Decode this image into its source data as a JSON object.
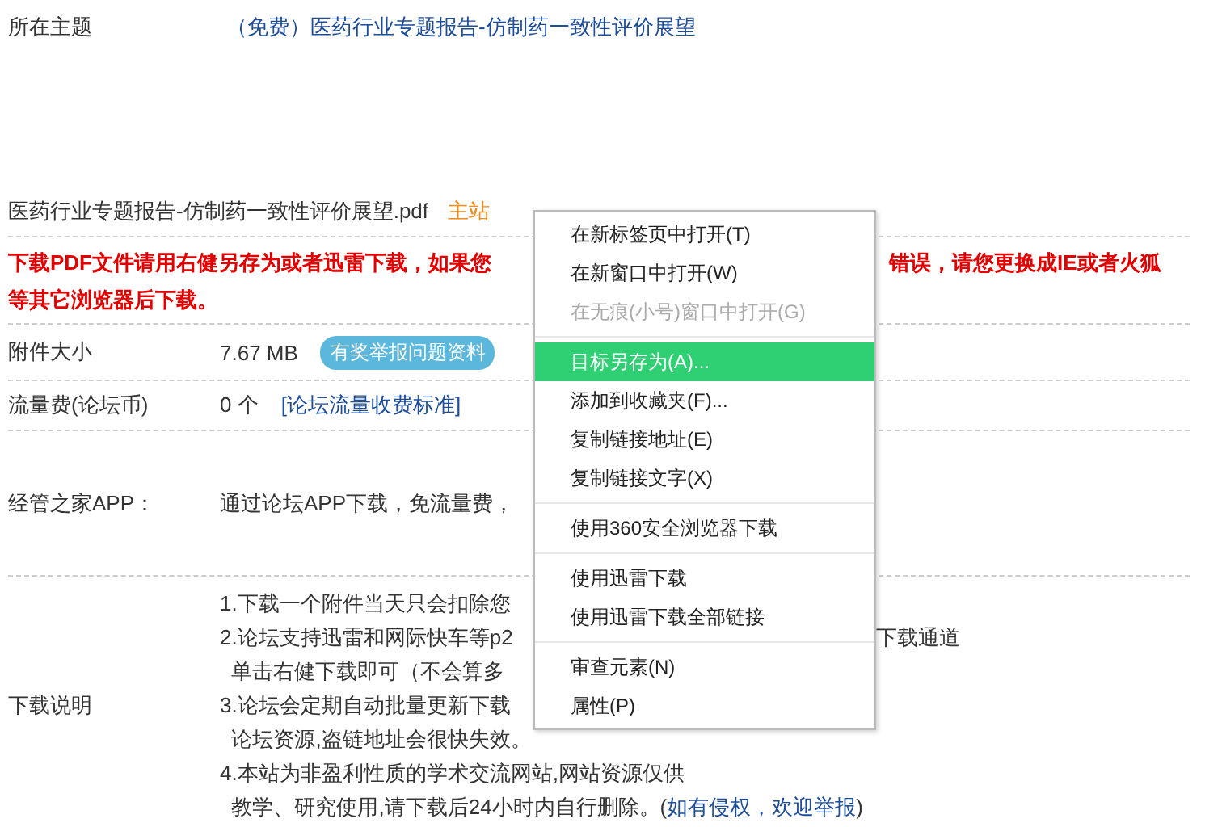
{
  "topic": {
    "label": "所在主题",
    "link": "（免费）医药行业专题报告-仿制药一致性评价展望"
  },
  "file": {
    "name": "医药行业专题报告-仿制药一致性评价展望.pdf",
    "download_link": "主站"
  },
  "notice": {
    "line_1_start": "下载PDF文件请用右健另存为或者迅雷下载，如果您",
    "line_1_end": "错误，请您更换成IE或者火狐",
    "line_2": "等其它浏览器后下载。"
  },
  "size": {
    "label": "附件大小",
    "value": "7.67 MB",
    "badge": "有奖举报问题资料"
  },
  "fee": {
    "label": "流量费(论坛币)",
    "value": "0 个",
    "link": "[论坛流量收费标准]"
  },
  "app": {
    "label": "经管之家APP：",
    "value": "通过论坛APP下载，免流量费，"
  },
  "notes": {
    "label": "下载说明",
    "lines": [
      {
        "text": "1.下载一个附件当天只会扣除您"
      },
      {
        "text": "2.论坛支持迅雷和网际快车等p2",
        "tail": "下载通道"
      },
      {
        "text": "  单击右健下载即可（不会算多"
      },
      {
        "text": "3.论坛会定期自动批量更新下载"
      },
      {
        "text": "  论坛资源,盗链地址会很快失效。"
      },
      {
        "text": "4.本站为非盈利性质的学术交流网站,网站资源仅供"
      },
      {
        "text": "  教学、研究使用,请下载后24小时内自行删除。(",
        "link": "如有侵权，欢迎举报",
        "after": ")"
      }
    ]
  },
  "context_menu": {
    "groups": [
      [
        {
          "label": "在新标签页中打开(T)",
          "disabled": false,
          "selected": false
        },
        {
          "label": "在新窗口中打开(W)",
          "disabled": false,
          "selected": false
        },
        {
          "label": "在无痕(小号)窗口中打开(G)",
          "disabled": true,
          "selected": false
        }
      ],
      [
        {
          "label": "目标另存为(A)...",
          "disabled": false,
          "selected": true
        },
        {
          "label": "添加到收藏夹(F)...",
          "disabled": false,
          "selected": false
        },
        {
          "label": "复制链接地址(E)",
          "disabled": false,
          "selected": false
        },
        {
          "label": "复制链接文字(X)",
          "disabled": false,
          "selected": false
        }
      ],
      [
        {
          "label": "使用360安全浏览器下载",
          "disabled": false,
          "selected": false
        }
      ],
      [
        {
          "label": "使用迅雷下载",
          "disabled": false,
          "selected": false
        },
        {
          "label": "使用迅雷下载全部链接",
          "disabled": false,
          "selected": false
        }
      ],
      [
        {
          "label": "审查元素(N)",
          "disabled": false,
          "selected": false
        },
        {
          "label": "属性(P)",
          "disabled": false,
          "selected": false
        }
      ]
    ]
  }
}
